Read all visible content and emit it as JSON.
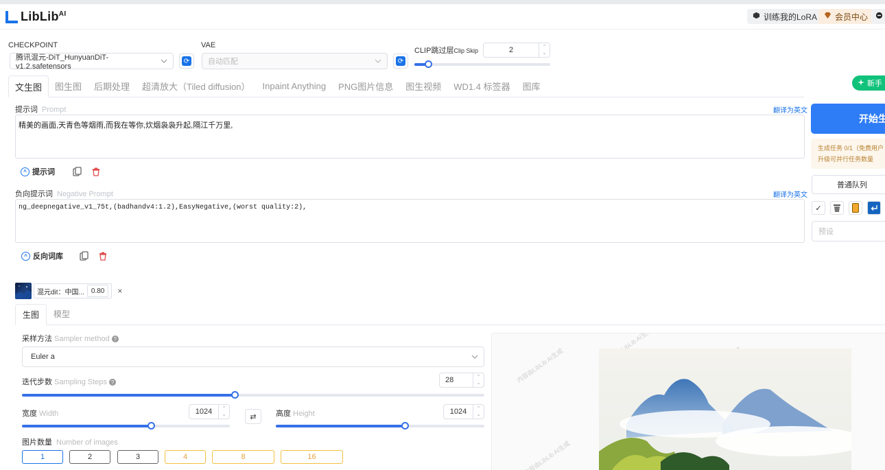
{
  "header": {
    "logo_text": "LibLib",
    "logo_sup": "AI",
    "lora_btn": "训练我的LoRA",
    "vip_btn": "会员中心"
  },
  "checkpoint": {
    "label": "CHECKPOINT",
    "value": "腾讯混元-DiT_HunyuanDiT-v1.2.safetensors"
  },
  "vae": {
    "label": "VAE",
    "value": "自动匹配"
  },
  "clip": {
    "label": "CLIP跳过层",
    "label_en": "Clip Skip",
    "value": "2",
    "fraction": 0.1
  },
  "tabs": [
    {
      "label": "文生图",
      "active": true
    },
    {
      "label": "图生图",
      "active": false
    },
    {
      "label": "后期处理",
      "active": false
    },
    {
      "label": "超清放大（Tiled diffusion）",
      "active": false
    },
    {
      "label": "Inpaint Anything",
      "active": false
    },
    {
      "label": "PNG图片信息",
      "active": false
    },
    {
      "label": "图生视频",
      "active": false
    },
    {
      "label": "WD1.4 标签器",
      "active": false
    },
    {
      "label": "图库",
      "active": false
    }
  ],
  "newbie_btn": "新手",
  "prompt": {
    "label": "提示词",
    "label_en": "Prompt",
    "translate": "翻译为英文",
    "text": "精美的画面,天青色等烟雨,而我在等你,炊烟袅袅升起,隔江千万里,",
    "toggle_label": "提示词"
  },
  "negative": {
    "label": "负向提示词",
    "label_en": "Negative Prompt",
    "translate": "翻译为英文",
    "text": "ng_deepnegative_v1_75t,(badhandv4:1.2),EasyNegative,(worst quality:2),",
    "toggle_label": "反向词库"
  },
  "right_panel": {
    "start_btn": "开始生",
    "info_line1": "生成任务 0/1（免费用户",
    "info_line2": "升级可并行任务数量",
    "queue": "普通队列",
    "preset_placeholder": "预设"
  },
  "lora": {
    "name": "混元dit：中国...",
    "weight": "0.80"
  },
  "subtabs": [
    {
      "label": "生图",
      "active": true
    },
    {
      "label": "模型",
      "active": false
    }
  ],
  "sampler": {
    "label": "采样方法",
    "label_en": "Sampler method",
    "value": "Euler a"
  },
  "steps": {
    "label": "迭代步数",
    "label_en": "Sampling Steps",
    "value": "28",
    "fraction": 0.46
  },
  "width": {
    "label": "宽度",
    "label_en": "Width",
    "value": "1024",
    "fraction": 0.62
  },
  "height": {
    "label": "高度",
    "label_en": "Height",
    "value": "1024",
    "fraction": 0.62
  },
  "num_images": {
    "label": "图片数量",
    "label_en": "Number of images",
    "options": [
      {
        "label": "1",
        "style": "blue"
      },
      {
        "label": "2",
        "style": "gray"
      },
      {
        "label": "3",
        "style": "gray"
      },
      {
        "label": "4",
        "style": "gold"
      },
      {
        "label": "8",
        "style": "gold"
      },
      {
        "label": "16",
        "style": "gold"
      }
    ]
  },
  "preview": {
    "watermark": "内容由LibLib AI生成"
  },
  "colors": {
    "accent": "#3670e8",
    "start_btn": "#2e7cf6",
    "newbie": "#10c27a",
    "gold": "#e6a23c"
  }
}
